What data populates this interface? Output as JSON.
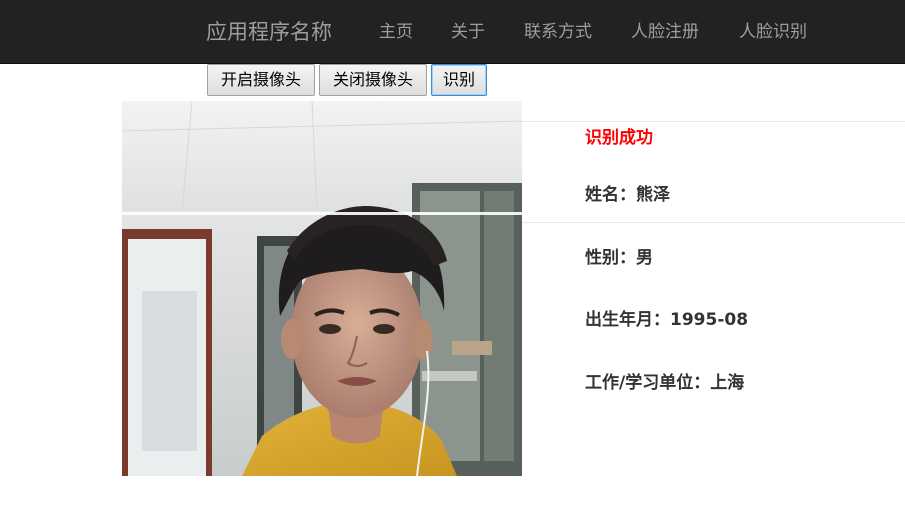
{
  "navbar": {
    "brand": "应用程序名称",
    "items": [
      {
        "label": "主页"
      },
      {
        "label": "关于"
      },
      {
        "label": "联系方式"
      },
      {
        "label": "人脸注册"
      },
      {
        "label": "人脸识别"
      }
    ]
  },
  "controls": {
    "open_camera": "开启摄像头",
    "close_camera": "关闭摄像头",
    "recognize": "识别"
  },
  "result": {
    "status": "识别成功",
    "name": "姓名：熊泽",
    "gender": "性别：男",
    "birth": "出生年月：1995-08",
    "workplace": "工作/学习单位：上海"
  },
  "colors": {
    "navbar_bg": "#222222",
    "nav_text": "#9d9d9d",
    "success": "#ff0000",
    "result_text": "#333333"
  }
}
